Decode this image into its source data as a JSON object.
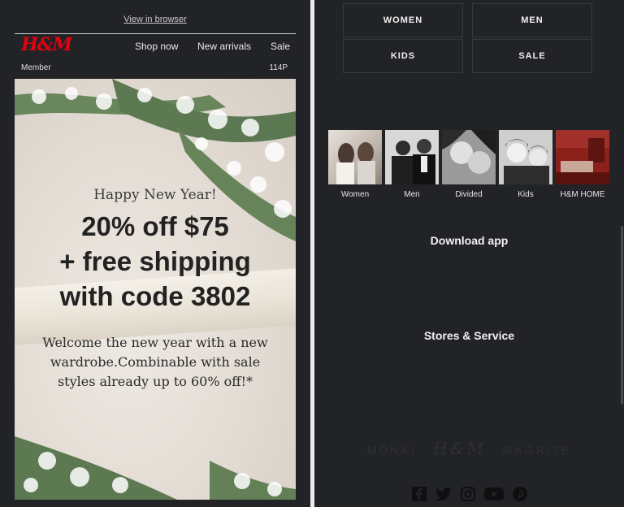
{
  "email": {
    "view_in_browser": "View in browser",
    "brand": "H&M",
    "nav": [
      "Shop now",
      "New arrivals",
      "Sale"
    ],
    "member_label": "Member",
    "points": "114P"
  },
  "hero": {
    "greeting": "Happy New Year!",
    "offer_lines": [
      "20% off $75",
      "+ free shipping",
      "with code 3802"
    ],
    "body": "Welcome the new year with a new wardrobe.Combinable with sale styles already up to 60% off!*"
  },
  "footer": {
    "categories": [
      "WOMEN",
      "MEN",
      "KIDS",
      "SALE"
    ],
    "departments": [
      "Women",
      "Men",
      "Divided",
      "Kids",
      "H&M HOME"
    ],
    "download_heading": "Download app",
    "stores_heading": "Stores & Service",
    "partner_logos": [
      "MONKI",
      "H&M",
      "MAGRITE"
    ],
    "social_icons": [
      "facebook-icon",
      "twitter-icon",
      "instagram-icon",
      "youtube-icon",
      "pinterest-icon"
    ]
  },
  "colors": {
    "brand_red": "#e50010",
    "dark_bg": "#222326"
  }
}
